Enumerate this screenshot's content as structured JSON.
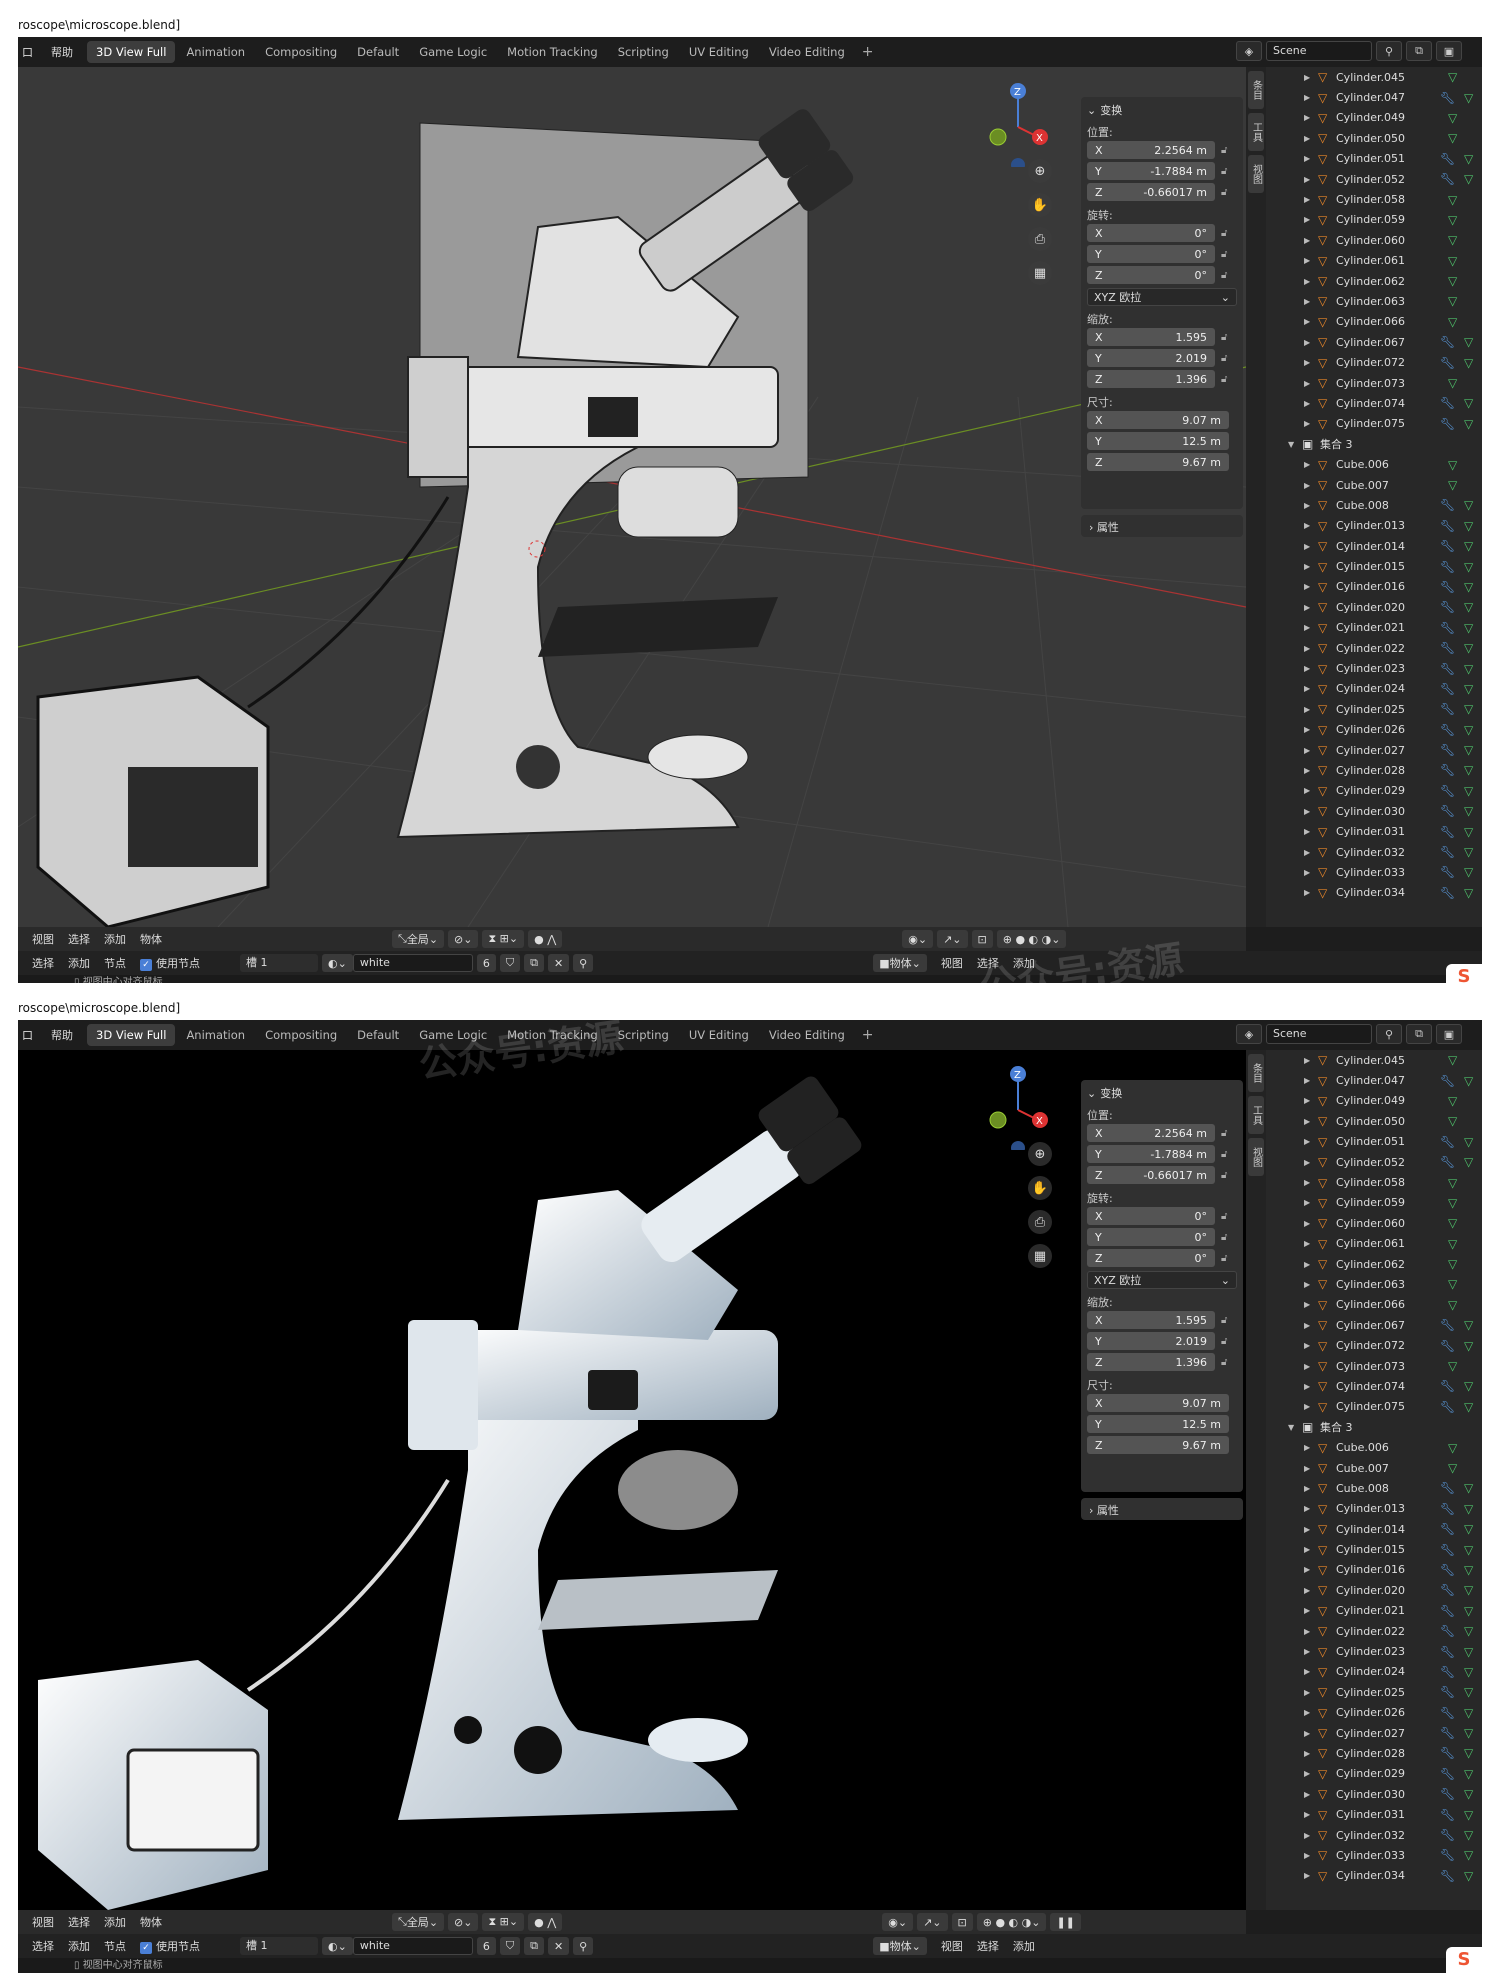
{
  "path": "roscope\\microscope.blend]",
  "menus": [
    "口",
    "帮助"
  ],
  "tabs": [
    "3D View Full",
    "Animation",
    "Compositing",
    "Default",
    "Game Logic",
    "Motion Tracking",
    "Scripting",
    "UV Editing",
    "Video Editing",
    "+"
  ],
  "scene_name": "Scene",
  "transform": {
    "header": "变换",
    "location_label": "位置:",
    "location": {
      "x": "2.2564 m",
      "y": "-1.7884 m",
      "z": "-0.66017 m"
    },
    "rotation_label": "旋转:",
    "rotation": {
      "x": "0°",
      "y": "0°",
      "z": "0°"
    },
    "rotation_mode": "XYZ 欧拉",
    "scale_label": "缩放:",
    "scale": {
      "x": "1.595",
      "y": "2.019",
      "z": "1.396"
    },
    "dims_label": "尺寸:",
    "dims": {
      "x": "9.07 m",
      "y": "12.5 m",
      "z": "9.67 m"
    },
    "axis": {
      "x": "X",
      "y": "Y",
      "z": "Z"
    }
  },
  "properties_label": "属性",
  "side_tabs": [
    "条目",
    "工具",
    "视图"
  ],
  "outliner": [
    {
      "name": "Cylinder.045",
      "type": "mesh",
      "wrench": false
    },
    {
      "name": "Cylinder.047",
      "type": "mesh",
      "wrench": true
    },
    {
      "name": "Cylinder.049",
      "type": "mesh",
      "wrench": false
    },
    {
      "name": "Cylinder.050",
      "type": "mesh",
      "wrench": false
    },
    {
      "name": "Cylinder.051",
      "type": "mesh",
      "wrench": true
    },
    {
      "name": "Cylinder.052",
      "type": "mesh",
      "wrench": true
    },
    {
      "name": "Cylinder.058",
      "type": "mesh",
      "wrench": false
    },
    {
      "name": "Cylinder.059",
      "type": "mesh",
      "wrench": false
    },
    {
      "name": "Cylinder.060",
      "type": "mesh",
      "wrench": false
    },
    {
      "name": "Cylinder.061",
      "type": "mesh",
      "wrench": false
    },
    {
      "name": "Cylinder.062",
      "type": "mesh",
      "wrench": false
    },
    {
      "name": "Cylinder.063",
      "type": "mesh",
      "wrench": false
    },
    {
      "name": "Cylinder.066",
      "type": "mesh",
      "wrench": false
    },
    {
      "name": "Cylinder.067",
      "type": "mesh",
      "wrench": true
    },
    {
      "name": "Cylinder.072",
      "type": "mesh",
      "wrench": true
    },
    {
      "name": "Cylinder.073",
      "type": "mesh",
      "wrench": false
    },
    {
      "name": "Cylinder.074",
      "type": "mesh",
      "wrench": true
    },
    {
      "name": "Cylinder.075",
      "type": "mesh",
      "wrench": true
    },
    {
      "name": "集合 3",
      "type": "collection",
      "wrench": false
    },
    {
      "name": "Cube.006",
      "type": "mesh",
      "wrench": false
    },
    {
      "name": "Cube.007",
      "type": "mesh",
      "wrench": false
    },
    {
      "name": "Cube.008",
      "type": "mesh",
      "wrench": true
    },
    {
      "name": "Cylinder.013",
      "type": "mesh",
      "wrench": true
    },
    {
      "name": "Cylinder.014",
      "type": "mesh",
      "wrench": true
    },
    {
      "name": "Cylinder.015",
      "type": "mesh",
      "wrench": true
    },
    {
      "name": "Cylinder.016",
      "type": "mesh",
      "wrench": true
    },
    {
      "name": "Cylinder.020",
      "type": "mesh",
      "wrench": true
    },
    {
      "name": "Cylinder.021",
      "type": "mesh",
      "wrench": true
    },
    {
      "name": "Cylinder.022",
      "type": "mesh",
      "wrench": true
    },
    {
      "name": "Cylinder.023",
      "type": "mesh",
      "wrench": true
    },
    {
      "name": "Cylinder.024",
      "type": "mesh",
      "wrench": true
    },
    {
      "name": "Cylinder.025",
      "type": "mesh",
      "wrench": true
    },
    {
      "name": "Cylinder.026",
      "type": "mesh",
      "wrench": true
    },
    {
      "name": "Cylinder.027",
      "type": "mesh",
      "wrench": true
    },
    {
      "name": "Cylinder.028",
      "type": "mesh",
      "wrench": true
    },
    {
      "name": "Cylinder.029",
      "type": "mesh",
      "wrench": true
    },
    {
      "name": "Cylinder.030",
      "type": "mesh",
      "wrench": true
    },
    {
      "name": "Cylinder.031",
      "type": "mesh",
      "wrench": true
    },
    {
      "name": "Cylinder.032",
      "type": "mesh",
      "wrench": true
    },
    {
      "name": "Cylinder.033",
      "type": "mesh",
      "wrench": true
    },
    {
      "name": "Cylinder.034",
      "type": "mesh",
      "wrench": true
    }
  ],
  "header_menus": [
    "视图",
    "选择",
    "添加",
    "物体"
  ],
  "transform_orient": "全局",
  "node_menus": [
    "选择",
    "添加",
    "节点"
  ],
  "use_nodes": "使用节点",
  "slot": "槽 1",
  "material": "white",
  "user_count": "6",
  "object_mode": "物体",
  "right_menus": [
    "视图",
    "选择",
    "添加"
  ],
  "status_text": "视图中心对齐鼠标",
  "watermark": "公众号:资源",
  "colors": {
    "mesh_icon": "#e8862a",
    "wrench": "#5a9be0",
    "filter": "#4ec06a",
    "accent": "#4a7fd6"
  }
}
